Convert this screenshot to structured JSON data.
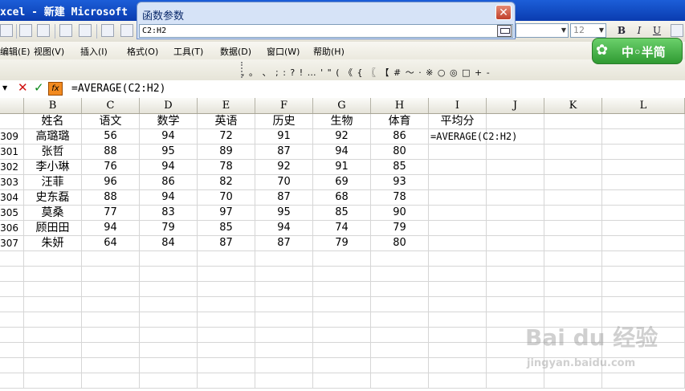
{
  "window": {
    "title": "xcel - 新建 Microsoft"
  },
  "dialog": {
    "title": "函数参数",
    "value": "C2:H2",
    "close_label": "✕"
  },
  "toolbar": {
    "font_size": "12",
    "bold": "B",
    "italic": "I",
    "underline": "U"
  },
  "menu": [
    "编辑(E)",
    "视图(V)",
    "插入(I)",
    "格式(O)",
    "工具(T)",
    "数据(D)",
    "窗口(W)",
    "帮助(H)"
  ],
  "symbols": ", 。 、 ; : ? ! … ' \" ( 《 { 〖 【 # ～ · ※ ○ ◎ □ + -",
  "formula_bar": {
    "content": "=AVERAGE(C2:H2)"
  },
  "columns": [
    "B",
    "C",
    "D",
    "E",
    "F",
    "G",
    "H",
    "I",
    "J",
    "K",
    "L"
  ],
  "header_row": [
    "姓名",
    "语文",
    "数学",
    "英语",
    "历史",
    "生物",
    "体育",
    "平均分"
  ],
  "rows": [
    {
      "id": "309",
      "name": "高璐璐",
      "scores": [
        56,
        94,
        72,
        91,
        92,
        86
      ],
      "avg": "=AVERAGE(C2:H2)"
    },
    {
      "id": "301",
      "name": "张哲",
      "scores": [
        88,
        95,
        89,
        87,
        94,
        80
      ],
      "avg": ""
    },
    {
      "id": "302",
      "name": "李小琳",
      "scores": [
        76,
        94,
        78,
        92,
        91,
        85
      ],
      "avg": ""
    },
    {
      "id": "303",
      "name": "汪菲",
      "scores": [
        96,
        86,
        82,
        70,
        69,
        93
      ],
      "avg": ""
    },
    {
      "id": "304",
      "name": "史东磊",
      "scores": [
        88,
        94,
        70,
        87,
        68,
        78
      ],
      "avg": ""
    },
    {
      "id": "305",
      "name": "莫桑",
      "scores": [
        77,
        83,
        97,
        95,
        85,
        90
      ],
      "avg": ""
    },
    {
      "id": "306",
      "name": "顾田田",
      "scores": [
        94,
        79,
        85,
        94,
        74,
        79
      ],
      "avg": ""
    },
    {
      "id": "307",
      "name": "朱妍",
      "scores": [
        64,
        84,
        87,
        87,
        79,
        80
      ],
      "avg": ""
    }
  ],
  "logo": {
    "text": "中◦半简"
  },
  "watermark": {
    "main": "Bai du 经验",
    "sub": "jingyan.baidu.com"
  }
}
